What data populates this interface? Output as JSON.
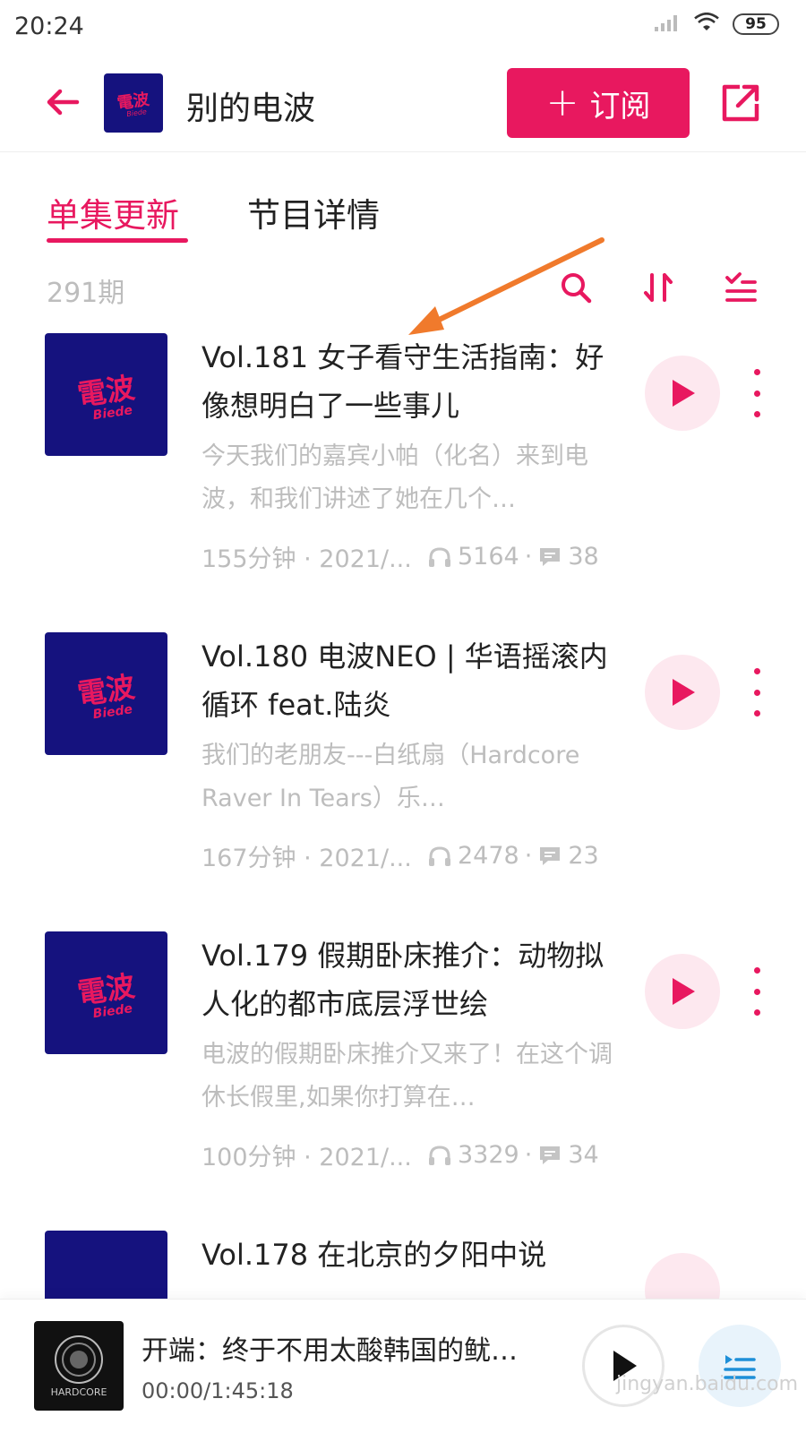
{
  "status_bar": {
    "time": "20:24",
    "battery": "95"
  },
  "header": {
    "title": "别的电波",
    "subscribe_label": "订阅"
  },
  "tabs": [
    {
      "label": "单集更新",
      "active": true
    },
    {
      "label": "节目详情",
      "active": false
    }
  ],
  "toolbar": {
    "count": "291期"
  },
  "episodes": [
    {
      "title": "Vol.181 女子看守生活指南：好像想明白了一些事儿",
      "description": "今天我们的嘉宾小帕（化名）来到电波，和我们讲述了她在几个…",
      "duration_date": "155分钟 · 2021/...",
      "listens": "5164",
      "comments": "38"
    },
    {
      "title": "Vol.180 电波NEO | 华语摇滚内循环 feat.陆炎",
      "description": "我们的老朋友---白纸扇（Hardcore Raver In Tears）乐…",
      "duration_date": "167分钟 · 2021/...",
      "listens": "2478",
      "comments": "23"
    },
    {
      "title": "Vol.179 假期卧床推介：动物拟人化的都市底层浮世绘",
      "description": "电波的假期卧床推介又来了！在这个调休长假里,如果你打算在…",
      "duration_date": "100分钟 · 2021/...",
      "listens": "3329",
      "comments": "34"
    },
    {
      "title": "Vol.178 在北京的夕阳中说"
    }
  ],
  "player": {
    "title": "开端：终于不用太酸韩国的鱿…",
    "time": "00:00/1:45:18"
  },
  "watermark": "jingyan.baidu.com",
  "colors": {
    "accent": "#e8185f",
    "cover_bg": "#15127e",
    "muted_text": "#bdbdbd"
  }
}
